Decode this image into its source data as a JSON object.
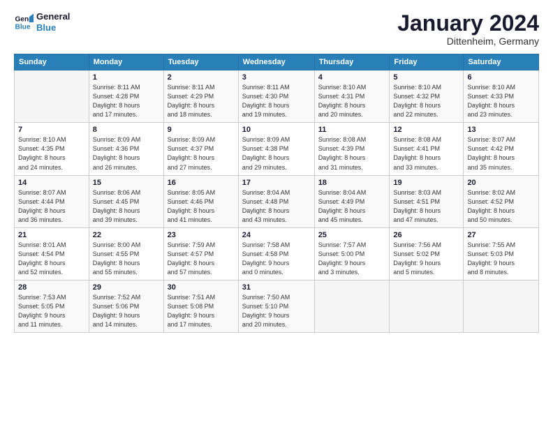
{
  "logo": {
    "line1": "General",
    "line2": "Blue"
  },
  "title": "January 2024",
  "subtitle": "Dittenheim, Germany",
  "header_days": [
    "Sunday",
    "Monday",
    "Tuesday",
    "Wednesday",
    "Thursday",
    "Friday",
    "Saturday"
  ],
  "weeks": [
    [
      {
        "num": "",
        "info": ""
      },
      {
        "num": "1",
        "info": "Sunrise: 8:11 AM\nSunset: 4:28 PM\nDaylight: 8 hours\nand 17 minutes."
      },
      {
        "num": "2",
        "info": "Sunrise: 8:11 AM\nSunset: 4:29 PM\nDaylight: 8 hours\nand 18 minutes."
      },
      {
        "num": "3",
        "info": "Sunrise: 8:11 AM\nSunset: 4:30 PM\nDaylight: 8 hours\nand 19 minutes."
      },
      {
        "num": "4",
        "info": "Sunrise: 8:10 AM\nSunset: 4:31 PM\nDaylight: 8 hours\nand 20 minutes."
      },
      {
        "num": "5",
        "info": "Sunrise: 8:10 AM\nSunset: 4:32 PM\nDaylight: 8 hours\nand 22 minutes."
      },
      {
        "num": "6",
        "info": "Sunrise: 8:10 AM\nSunset: 4:33 PM\nDaylight: 8 hours\nand 23 minutes."
      }
    ],
    [
      {
        "num": "7",
        "info": "Sunrise: 8:10 AM\nSunset: 4:35 PM\nDaylight: 8 hours\nand 24 minutes."
      },
      {
        "num": "8",
        "info": "Sunrise: 8:09 AM\nSunset: 4:36 PM\nDaylight: 8 hours\nand 26 minutes."
      },
      {
        "num": "9",
        "info": "Sunrise: 8:09 AM\nSunset: 4:37 PM\nDaylight: 8 hours\nand 27 minutes."
      },
      {
        "num": "10",
        "info": "Sunrise: 8:09 AM\nSunset: 4:38 PM\nDaylight: 8 hours\nand 29 minutes."
      },
      {
        "num": "11",
        "info": "Sunrise: 8:08 AM\nSunset: 4:39 PM\nDaylight: 8 hours\nand 31 minutes."
      },
      {
        "num": "12",
        "info": "Sunrise: 8:08 AM\nSunset: 4:41 PM\nDaylight: 8 hours\nand 33 minutes."
      },
      {
        "num": "13",
        "info": "Sunrise: 8:07 AM\nSunset: 4:42 PM\nDaylight: 8 hours\nand 35 minutes."
      }
    ],
    [
      {
        "num": "14",
        "info": "Sunrise: 8:07 AM\nSunset: 4:44 PM\nDaylight: 8 hours\nand 36 minutes."
      },
      {
        "num": "15",
        "info": "Sunrise: 8:06 AM\nSunset: 4:45 PM\nDaylight: 8 hours\nand 39 minutes."
      },
      {
        "num": "16",
        "info": "Sunrise: 8:05 AM\nSunset: 4:46 PM\nDaylight: 8 hours\nand 41 minutes."
      },
      {
        "num": "17",
        "info": "Sunrise: 8:04 AM\nSunset: 4:48 PM\nDaylight: 8 hours\nand 43 minutes."
      },
      {
        "num": "18",
        "info": "Sunrise: 8:04 AM\nSunset: 4:49 PM\nDaylight: 8 hours\nand 45 minutes."
      },
      {
        "num": "19",
        "info": "Sunrise: 8:03 AM\nSunset: 4:51 PM\nDaylight: 8 hours\nand 47 minutes."
      },
      {
        "num": "20",
        "info": "Sunrise: 8:02 AM\nSunset: 4:52 PM\nDaylight: 8 hours\nand 50 minutes."
      }
    ],
    [
      {
        "num": "21",
        "info": "Sunrise: 8:01 AM\nSunset: 4:54 PM\nDaylight: 8 hours\nand 52 minutes."
      },
      {
        "num": "22",
        "info": "Sunrise: 8:00 AM\nSunset: 4:55 PM\nDaylight: 8 hours\nand 55 minutes."
      },
      {
        "num": "23",
        "info": "Sunrise: 7:59 AM\nSunset: 4:57 PM\nDaylight: 8 hours\nand 57 minutes."
      },
      {
        "num": "24",
        "info": "Sunrise: 7:58 AM\nSunset: 4:58 PM\nDaylight: 9 hours\nand 0 minutes."
      },
      {
        "num": "25",
        "info": "Sunrise: 7:57 AM\nSunset: 5:00 PM\nDaylight: 9 hours\nand 3 minutes."
      },
      {
        "num": "26",
        "info": "Sunrise: 7:56 AM\nSunset: 5:02 PM\nDaylight: 9 hours\nand 5 minutes."
      },
      {
        "num": "27",
        "info": "Sunrise: 7:55 AM\nSunset: 5:03 PM\nDaylight: 9 hours\nand 8 minutes."
      }
    ],
    [
      {
        "num": "28",
        "info": "Sunrise: 7:53 AM\nSunset: 5:05 PM\nDaylight: 9 hours\nand 11 minutes."
      },
      {
        "num": "29",
        "info": "Sunrise: 7:52 AM\nSunset: 5:06 PM\nDaylight: 9 hours\nand 14 minutes."
      },
      {
        "num": "30",
        "info": "Sunrise: 7:51 AM\nSunset: 5:08 PM\nDaylight: 9 hours\nand 17 minutes."
      },
      {
        "num": "31",
        "info": "Sunrise: 7:50 AM\nSunset: 5:10 PM\nDaylight: 9 hours\nand 20 minutes."
      },
      {
        "num": "",
        "info": ""
      },
      {
        "num": "",
        "info": ""
      },
      {
        "num": "",
        "info": ""
      }
    ]
  ]
}
